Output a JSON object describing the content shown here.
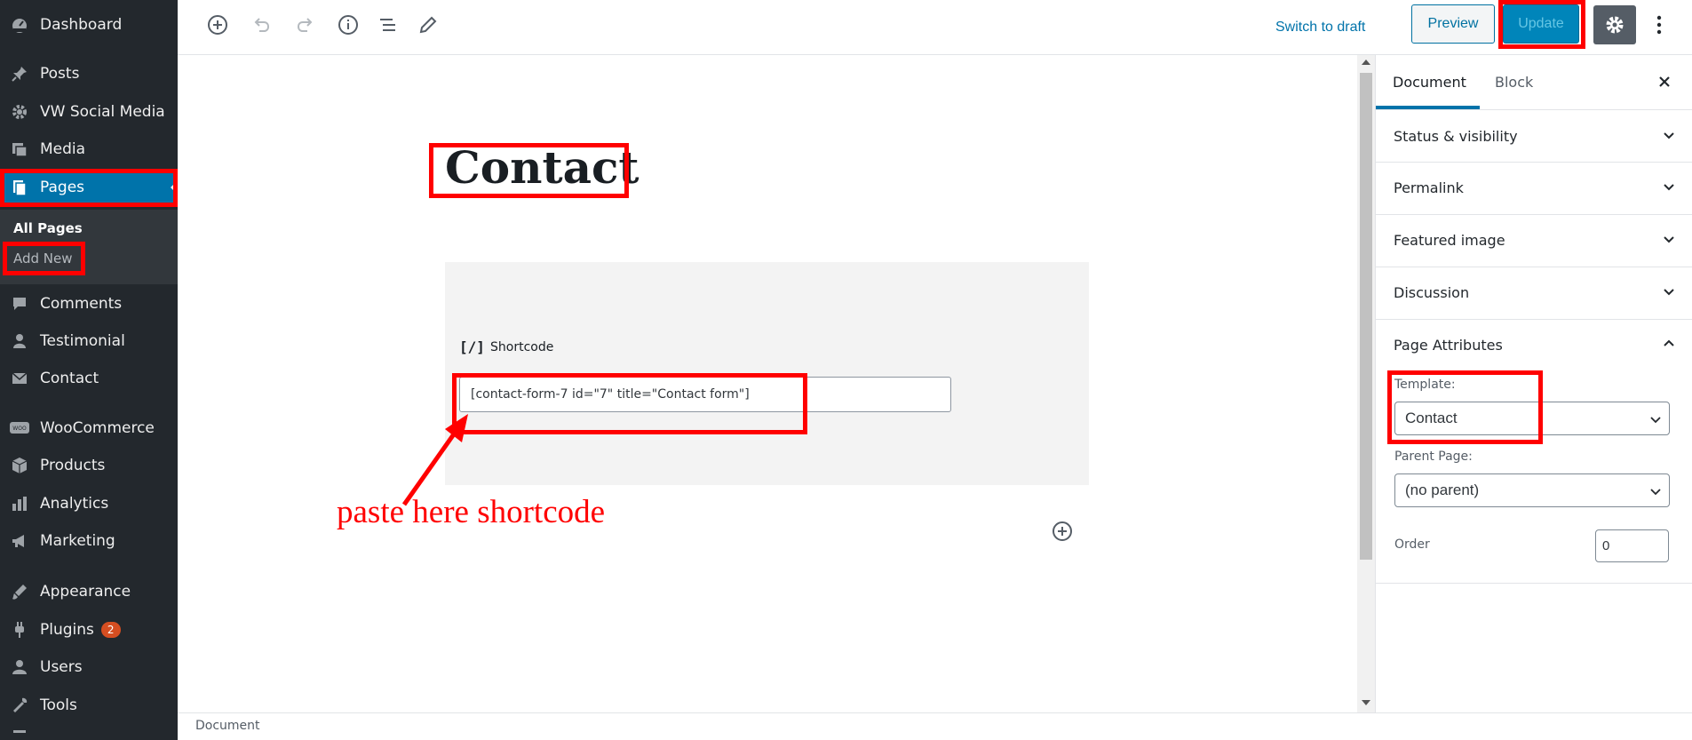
{
  "sidebar": {
    "items": [
      {
        "label": "Dashboard",
        "icon": "dashboard-icon"
      },
      {
        "label": "Posts",
        "icon": "pin-icon"
      },
      {
        "label": "VW Social Media",
        "icon": "gear-icon"
      },
      {
        "label": "Media",
        "icon": "media-icon"
      },
      {
        "label": "Pages",
        "icon": "pages-icon"
      },
      {
        "label": "Comments",
        "icon": "comment-icon"
      },
      {
        "label": "Testimonial",
        "icon": "person-icon"
      },
      {
        "label": "Contact",
        "icon": "mail-icon"
      },
      {
        "label": "WooCommerce",
        "icon": "woo-icon"
      },
      {
        "label": "Products",
        "icon": "box-icon"
      },
      {
        "label": "Analytics",
        "icon": "chart-icon"
      },
      {
        "label": "Marketing",
        "icon": "megaphone-icon"
      },
      {
        "label": "Appearance",
        "icon": "brush-icon"
      },
      {
        "label": "Plugins",
        "icon": "plug-icon",
        "badge": "2"
      },
      {
        "label": "Users",
        "icon": "user-icon"
      },
      {
        "label": "Tools",
        "icon": "wrench-icon"
      }
    ],
    "submenu": {
      "all_pages": "All Pages",
      "add_new": "Add New"
    }
  },
  "toolbar": {
    "switch_to_draft": "Switch to draft",
    "preview": "Preview",
    "update": "Update"
  },
  "editor": {
    "title": "Contact",
    "block_label": "Shortcode",
    "shortcode_value": "[contact-form-7 id=\"7\" title=\"Contact form\"]",
    "annotation": "paste here shortcode"
  },
  "settings": {
    "tabs": {
      "document": "Document",
      "block": "Block"
    },
    "panels": {
      "status": "Status & visibility",
      "permalink": "Permalink",
      "featured": "Featured image",
      "discussion": "Discussion",
      "attributes": "Page Attributes"
    },
    "template_label": "Template:",
    "template_value": "Contact",
    "parent_label": "Parent Page:",
    "parent_value": "(no parent)",
    "order_label": "Order",
    "order_value": "0"
  },
  "footer": {
    "breadcrumb": "Document"
  },
  "colors": {
    "accent": "#0073aa",
    "highlight": "#ff0000",
    "admin_bg": "#23282d"
  }
}
